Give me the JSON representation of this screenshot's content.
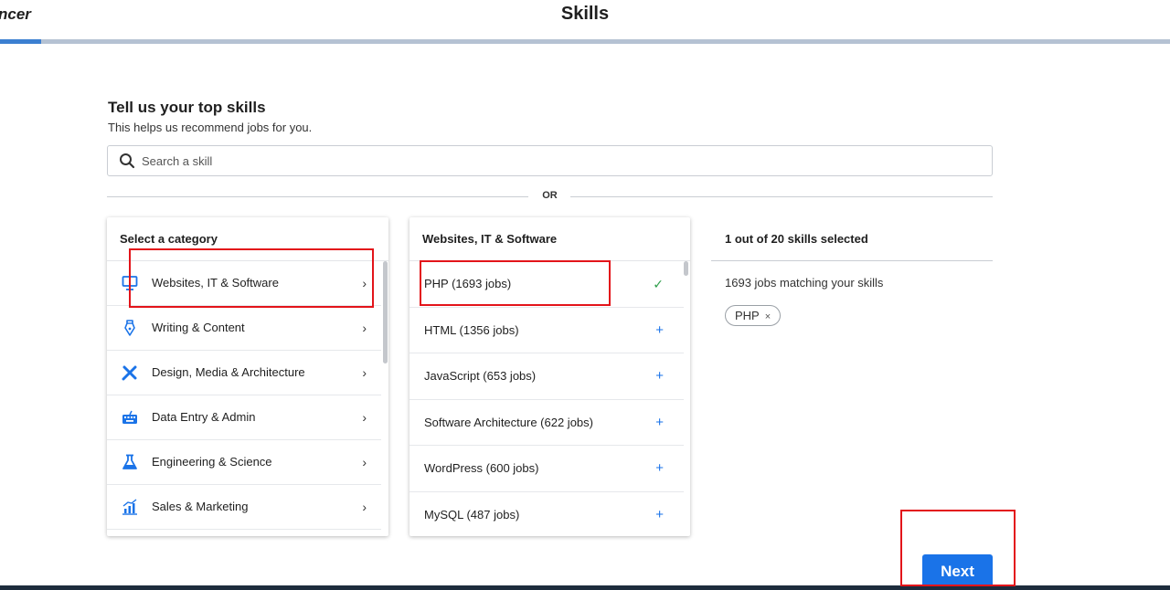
{
  "app": {
    "logo_text": "ncer",
    "page_title": "Skills"
  },
  "progress": {
    "fraction": 0.035
  },
  "intro": {
    "heading": "Tell us your top skills",
    "subheading": "This helps us recommend jobs for you."
  },
  "search": {
    "placeholder": "Search a skill",
    "value": ""
  },
  "divider": {
    "text": "OR"
  },
  "categories": {
    "header": "Select a category",
    "items": [
      {
        "label": "Websites, IT & Software",
        "icon": "monitor-icon",
        "chevron": "›"
      },
      {
        "label": "Writing & Content",
        "icon": "pen-nib-icon",
        "chevron": "›"
      },
      {
        "label": "Design, Media & Architecture",
        "icon": "design-tools-icon",
        "chevron": "›"
      },
      {
        "label": "Data Entry & Admin",
        "icon": "keyboard-icon",
        "chevron": "›"
      },
      {
        "label": "Engineering & Science",
        "icon": "flask-icon",
        "chevron": "›"
      },
      {
        "label": "Sales & Marketing",
        "icon": "chart-icon",
        "chevron": "›"
      }
    ]
  },
  "skills": {
    "header": "Websites, IT & Software",
    "items": [
      {
        "label": "PHP (1693 jobs)",
        "selected": true,
        "action": "✓"
      },
      {
        "label": "HTML (1356 jobs)",
        "selected": false,
        "action": "+"
      },
      {
        "label": "JavaScript (653 jobs)",
        "selected": false,
        "action": "+"
      },
      {
        "label": "Software Architecture (622 jobs)",
        "selected": false,
        "action": "+"
      },
      {
        "label": "WordPress (600 jobs)",
        "selected": false,
        "action": "+"
      },
      {
        "label": "MySQL (487 jobs)",
        "selected": false,
        "action": "+"
      }
    ]
  },
  "selection": {
    "summary": "1 out of 20 skills selected",
    "jobs_matching": "1693 jobs matching your skills",
    "chips": [
      {
        "label": "PHP",
        "remove": "×"
      }
    ]
  },
  "actions": {
    "next_label": "Next"
  },
  "colors": {
    "accent": "#1a73e8",
    "success": "#2e9e4a",
    "highlight": "#e3141a"
  }
}
